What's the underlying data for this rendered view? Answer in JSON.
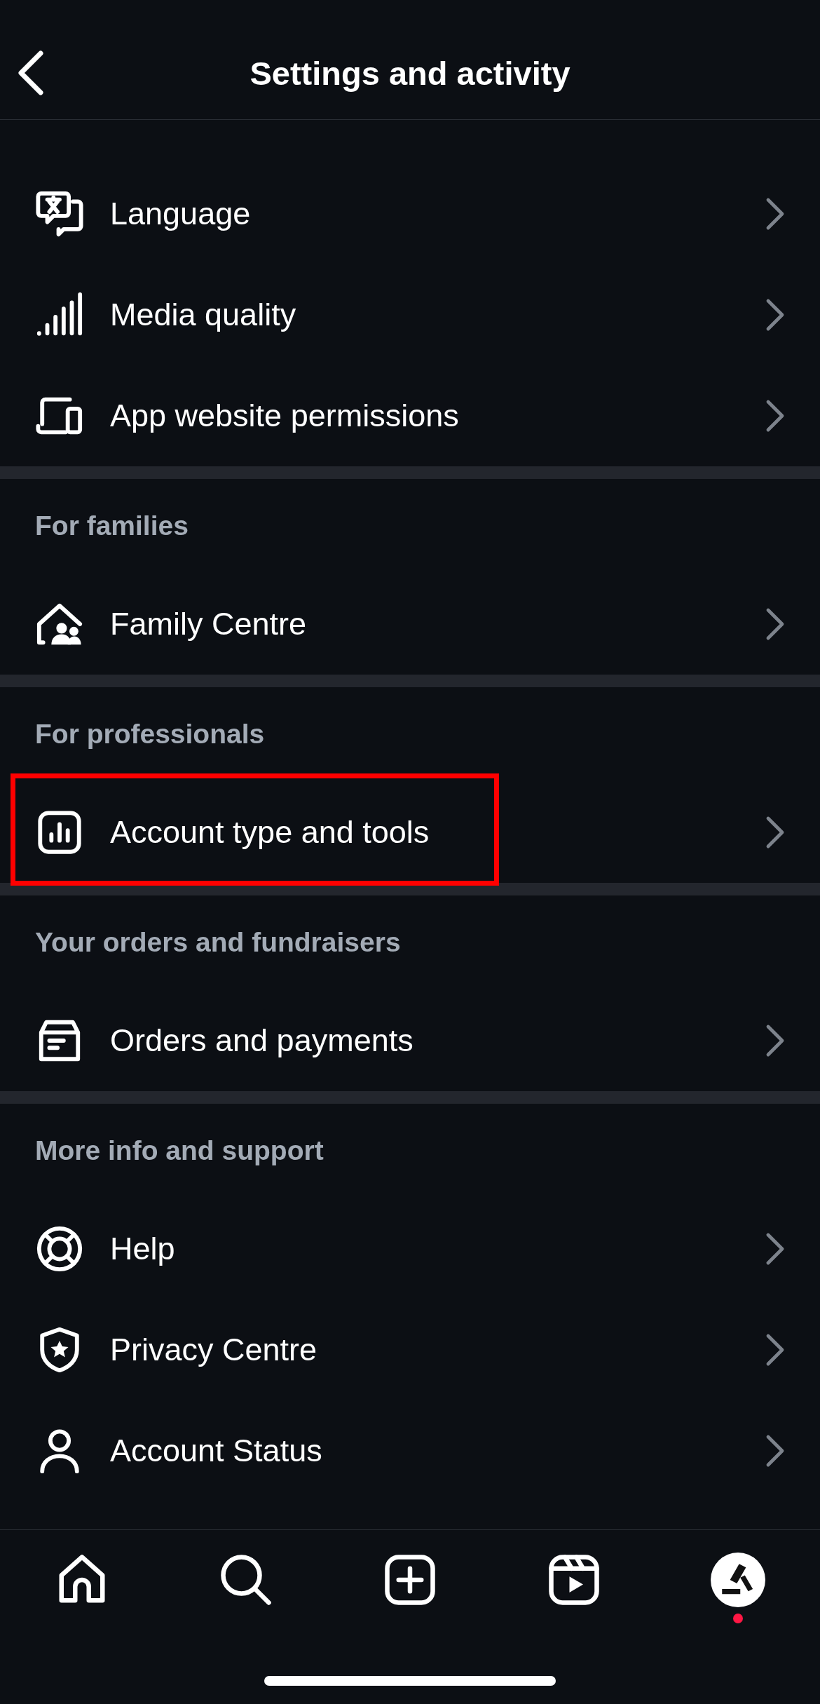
{
  "header": {
    "title": "Settings and activity"
  },
  "sections": [
    {
      "items": [
        {
          "label": "Language",
          "highlighted": false
        },
        {
          "label": "Media quality",
          "highlighted": false
        },
        {
          "label": "App website permissions",
          "highlighted": false
        }
      ]
    },
    {
      "heading": "For families",
      "items": [
        {
          "label": "Family Centre",
          "highlighted": false
        }
      ]
    },
    {
      "heading": "For professionals",
      "items": [
        {
          "label": "Account type and tools",
          "highlighted": true
        }
      ]
    },
    {
      "heading": "Your orders and fundraisers",
      "items": [
        {
          "label": "Orders and payments",
          "highlighted": false
        }
      ]
    },
    {
      "heading": "More info and support",
      "items": [
        {
          "label": "Help",
          "highlighted": false
        },
        {
          "label": "Privacy Centre",
          "highlighted": false
        },
        {
          "label": "Account Status",
          "highlighted": false
        }
      ]
    }
  ],
  "nav": [
    {
      "notification": false
    },
    {
      "notification": false
    },
    {
      "notification": false
    },
    {
      "notification": false
    },
    {
      "notification": true
    }
  ]
}
